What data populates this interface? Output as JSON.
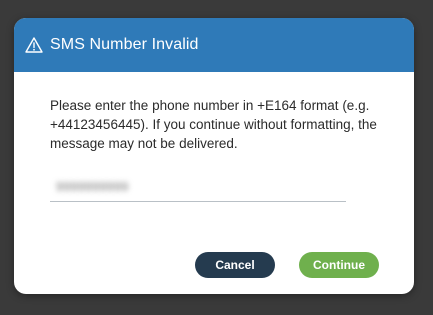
{
  "dialog": {
    "title": "SMS Number Invalid",
    "icon": "warning-icon",
    "message": "Please enter the phone number in +E164 format (e.g. +44123456445). If you continue without formatting, the message may not be delivered.",
    "phone_value": "9999999999",
    "cancel_label": "Cancel",
    "continue_label": "Continue"
  },
  "colors": {
    "header": "#2f7ab8",
    "cancel": "#253b4f",
    "continue": "#6fb04d"
  }
}
